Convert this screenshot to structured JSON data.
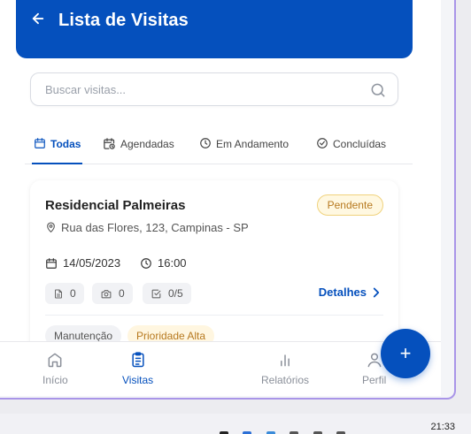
{
  "header": {
    "title": "Lista de Visitas",
    "back_icon": "arrow-left-icon"
  },
  "search": {
    "placeholder": "Buscar visitas...",
    "value": ""
  },
  "tabs": [
    {
      "label": "Todas",
      "icon": "calendar-icon",
      "active": true
    },
    {
      "label": "Agendadas",
      "icon": "calendar-clock-icon",
      "active": false
    },
    {
      "label": "Em Andamento",
      "icon": "clock-icon",
      "active": false
    },
    {
      "label": "Concluídas",
      "icon": "check-circle-icon",
      "active": false
    }
  ],
  "visit": {
    "name": "Residencial Palmeiras",
    "status": "Pendente",
    "address": "Rua das Flores, 123, Campinas - SP",
    "date": "14/05/2023",
    "time": "16:00",
    "documents": "0",
    "photos": "0",
    "checklist": "0/5",
    "details_label": "Detalhes",
    "tags": [
      "Manutenção",
      "Prioridade Alta"
    ]
  },
  "nav": {
    "items": [
      {
        "label": "Início",
        "icon": "home-icon",
        "active": false
      },
      {
        "label": "Visitas",
        "icon": "clipboard-icon",
        "active": true
      },
      {
        "label": "Relatórios",
        "icon": "bar-chart-icon",
        "active": false
      },
      {
        "label": "Perfil",
        "icon": "user-icon",
        "active": false
      }
    ],
    "fab_label": "+"
  },
  "taskbar": {
    "clock": "21:33"
  },
  "colors": {
    "primary": "#0550bd",
    "pending_bg": "#fff8e1",
    "pending_text": "#b7791f"
  }
}
